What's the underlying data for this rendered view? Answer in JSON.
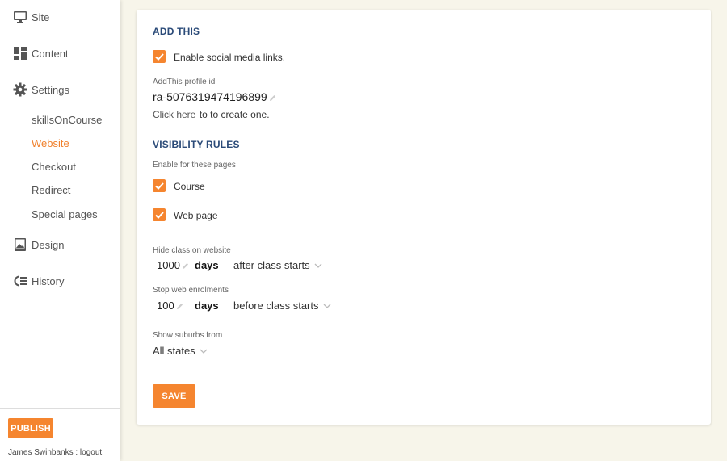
{
  "sidebar": {
    "items": [
      {
        "label": "Site",
        "icon": "monitor-icon"
      },
      {
        "label": "Content",
        "icon": "dashboard-icon"
      },
      {
        "label": "Settings",
        "icon": "gear-icon"
      },
      {
        "label": "Design",
        "icon": "image-icon"
      },
      {
        "label": "History",
        "icon": "history-icon"
      }
    ],
    "sub_items": [
      {
        "label": "skillsOnCourse",
        "active": false
      },
      {
        "label": "Website",
        "active": true
      },
      {
        "label": "Checkout",
        "active": false
      },
      {
        "label": "Redirect",
        "active": false
      },
      {
        "label": "Special pages",
        "active": false
      }
    ],
    "publish_label": "PUBLISH",
    "user_line": "James Swinbanks : logout"
  },
  "addthis": {
    "title": "ADD THIS",
    "enable_label": "Enable social media links.",
    "enable_checked": true,
    "profile_label": "AddThis profile id",
    "profile_value": "ra-5076319474196899",
    "click_here": "Click here",
    "create_text": "to to create one."
  },
  "visibility": {
    "title": "VISIBILITY RULES",
    "pages_label": "Enable for these pages",
    "course_label": "Course",
    "course_checked": true,
    "webpage_label": "Web page",
    "webpage_checked": true,
    "hide_label": "Hide class on website",
    "hide_value": "1000",
    "hide_unit": "days",
    "hide_when": "after class starts",
    "stop_label": "Stop web enrolments",
    "stop_value": "100",
    "stop_unit": "days",
    "stop_when": "before class starts",
    "suburbs_label": "Show suburbs from",
    "suburbs_value": "All states"
  },
  "save_label": "SAVE",
  "colors": {
    "accent": "#f5852f",
    "heading": "#2a4a78",
    "background": "#f7f5ea"
  }
}
